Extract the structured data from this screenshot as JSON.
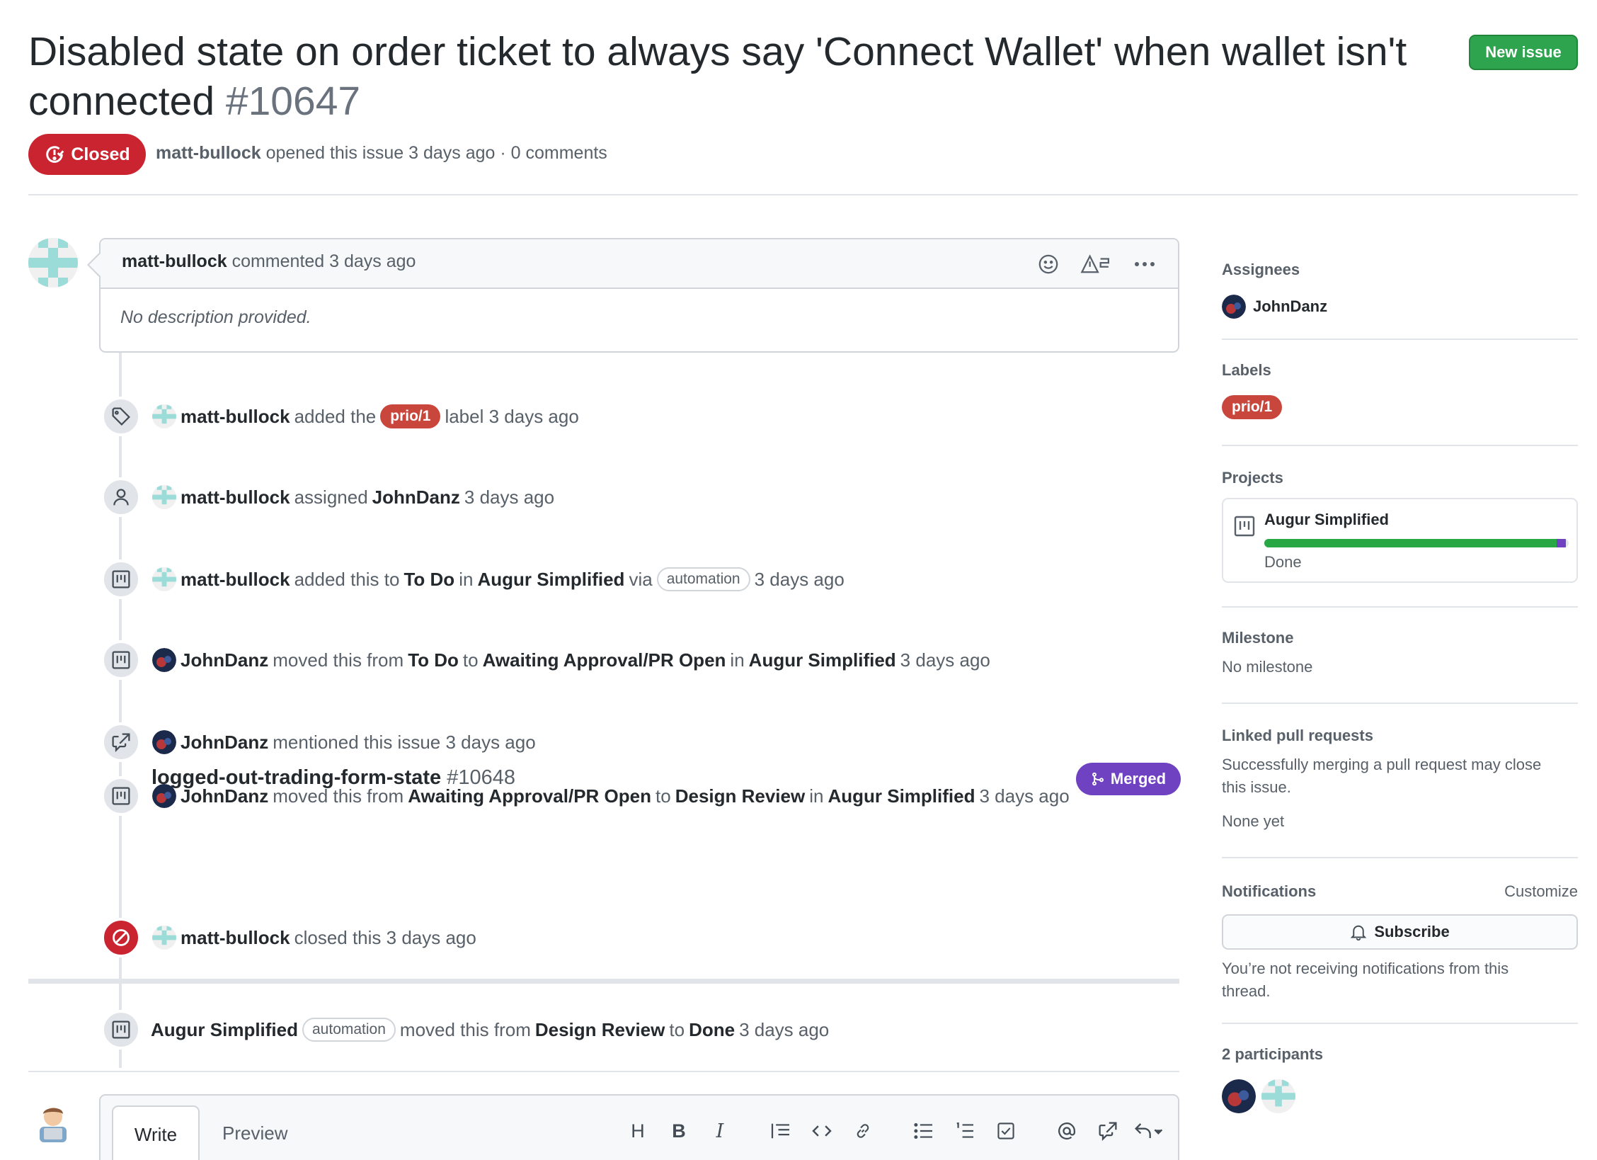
{
  "issue": {
    "title": "Disabled state on order ticket to always say 'Connect Wallet' when wallet isn't connected",
    "number": "#10647",
    "state": "Closed",
    "author": "matt-bullock",
    "opened_text": "opened this issue 3 days ago · 0 comments",
    "new_issue_label": "New issue"
  },
  "comment": {
    "author": "matt-bullock",
    "action": "commented 3 days ago",
    "body": "No description provided."
  },
  "events": {
    "label": {
      "actor": "matt-bullock",
      "pre": "added the",
      "label": "prio/1",
      "post": "label 3 days ago"
    },
    "assign": {
      "actor": "matt-bullock",
      "pre": "assigned",
      "assignee": "JohnDanz",
      "post": "3 days ago"
    },
    "project_add": {
      "actor": "matt-bullock",
      "pre": "added this to",
      "column": "To Do",
      "in": "in",
      "project": "Augur Simplified",
      "via": "via",
      "badge": "automation",
      "post": "3 days ago"
    },
    "move1": {
      "actor": "JohnDanz",
      "pre": "moved this from",
      "from": "To Do",
      "to_word": "to",
      "to": "Awaiting Approval/PR Open",
      "in": "in",
      "project": "Augur Simplified",
      "post": "3 days ago"
    },
    "mention": {
      "actor": "JohnDanz",
      "post": "mentioned this issue 3 days ago",
      "pr_title": "logged-out-trading-form-state",
      "pr_number": "#10648",
      "pr_state": "Merged"
    },
    "move2": {
      "actor": "JohnDanz",
      "pre": "moved this from",
      "from": "Awaiting Approval/PR Open",
      "to_word": "to",
      "to": "Design Review",
      "in": "in",
      "project": "Augur Simplified",
      "post": "3 days ago"
    },
    "closed": {
      "actor": "matt-bullock",
      "post": "closed this 3 days ago"
    },
    "move3": {
      "actor": "Augur Simplified",
      "badge": "automation",
      "pre": "moved this from",
      "from": "Design Review",
      "to_word": "to",
      "to": "Done",
      "post": "3 days ago"
    }
  },
  "composer": {
    "write_tab": "Write",
    "preview_tab": "Preview",
    "tools": [
      "H",
      "B",
      "I",
      "quote-icon",
      "code-icon",
      "link-icon",
      "bullet-list-icon",
      "numbered-list-icon",
      "task-list-icon",
      "mention-icon",
      "cross-reference-icon",
      "reply-icon"
    ]
  },
  "sidebar": {
    "assignees_heading": "Assignees",
    "assignee": "JohnDanz",
    "labels_heading": "Labels",
    "label": "prio/1",
    "projects_heading": "Projects",
    "project_name": "Augur Simplified",
    "project_column": "Done",
    "project_progress": {
      "done": 0.96,
      "in_progress": 0.03
    },
    "milestone_heading": "Milestone",
    "milestone_value": "No milestone",
    "linked_heading": "Linked pull requests",
    "linked_desc": "Successfully merging a pull request may close this issue.",
    "linked_value": "None yet",
    "notifications_heading": "Notifications",
    "customize": "Customize",
    "subscribe": "Subscribe",
    "notif_desc": "You’re not receiving notifications from this thread.",
    "participants_heading": "2 participants"
  },
  "colors": {
    "closed": "#cb2431",
    "label": "#c9463d",
    "merged": "#6f42c1",
    "new_issue": "#2ea44f",
    "progress_done": "#28a745"
  }
}
